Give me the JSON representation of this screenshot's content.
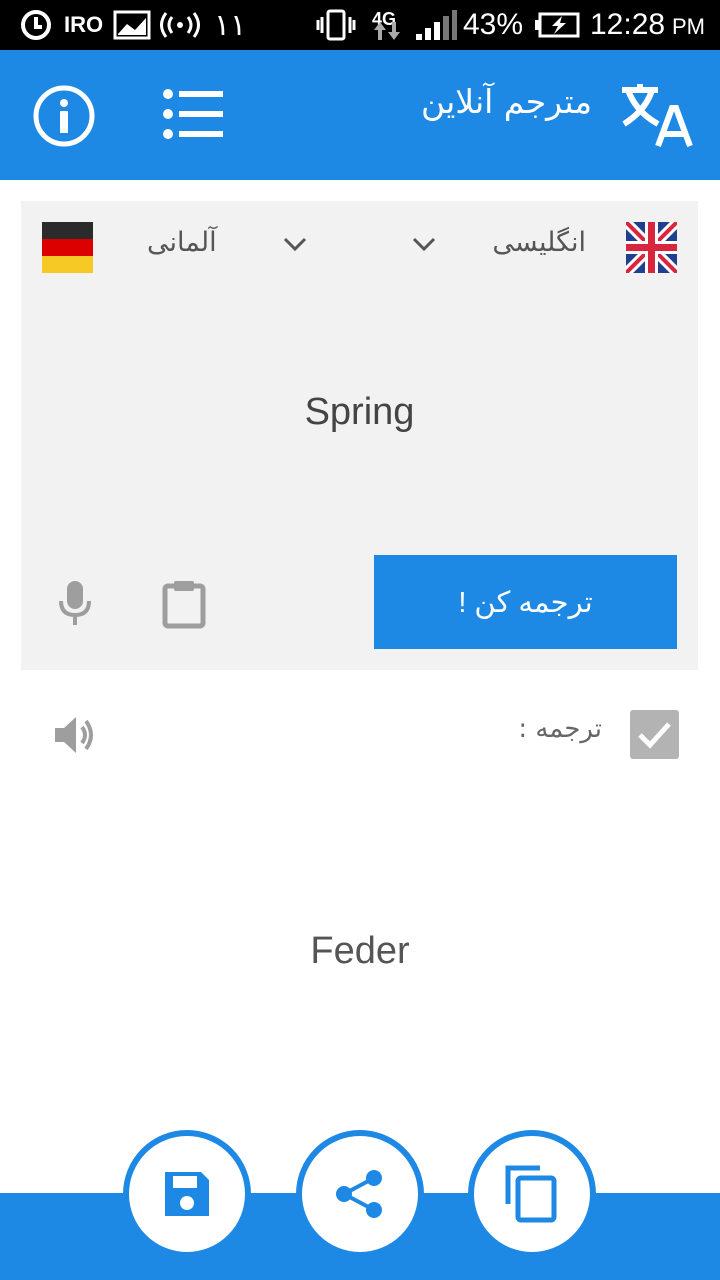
{
  "status_bar": {
    "carrier": "IRO",
    "sim_label": "١١",
    "network": "4G",
    "battery": "43%",
    "time": "12:28",
    "ampm": "PM"
  },
  "app_bar": {
    "title": "مترجم آنلاین"
  },
  "source": {
    "from_language": "انگلیسی",
    "to_language": "آلمانی",
    "text": "Spring",
    "translate_button": "ترجمه کن !"
  },
  "result": {
    "label": "ترجمه :",
    "text": "Feder",
    "checked": true
  },
  "colors": {
    "primary": "#1e88e5",
    "card_bg": "#f2f2f2",
    "icon_gray": "#9e9e9e"
  },
  "icons": [
    "info-icon",
    "menu-list-icon",
    "translate-icon",
    "uk-flag-icon",
    "germany-flag-icon",
    "chevron-down-icon",
    "microphone-icon",
    "clipboard-icon",
    "speaker-icon",
    "checkbox-icon",
    "save-icon",
    "share-icon",
    "copy-icon"
  ]
}
